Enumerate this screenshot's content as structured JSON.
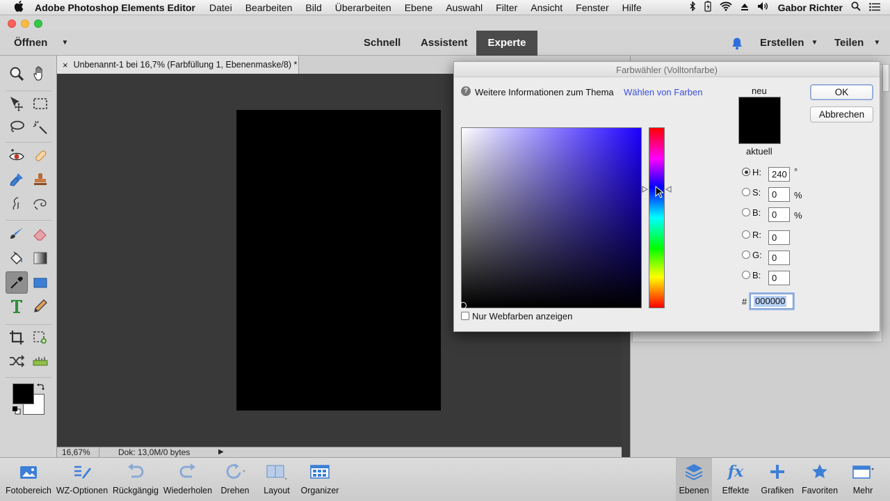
{
  "menubar": {
    "app_name": "Adobe Photoshop Elements Editor",
    "items": [
      "Datei",
      "Bearbeiten",
      "Bild",
      "Überarbeiten",
      "Ebene",
      "Auswahl",
      "Filter",
      "Ansicht",
      "Fenster",
      "Hilfe"
    ],
    "user": "Gabor Richter"
  },
  "topbar": {
    "open_label": "Öffnen",
    "modes": [
      "Schnell",
      "Assistent",
      "Experte"
    ],
    "active_mode": "Experte",
    "create_label": "Erstellen",
    "share_label": "Teilen"
  },
  "document": {
    "tab_title": "Unbenannt-1 bei 16,7% (Farbfüllung 1, Ebenenmaske/8) *",
    "zoom": "16,67%",
    "doc_info": "Dok: 13,0M/0 bytes"
  },
  "bottombar": {
    "items": [
      "Fotobereich",
      "WZ-Optionen",
      "Rückgängig",
      "Wiederholen",
      "Drehen",
      "Layout",
      "Organizer"
    ],
    "panels": [
      "Ebenen",
      "Effekte",
      "Grafiken",
      "Favoriten",
      "Mehr"
    ]
  },
  "dialog": {
    "title": "Farbwähler (Volltonfarbe)",
    "info_text": "Weitere Informationen zum Thema",
    "info_link": "Wählen von Farben",
    "new_label": "neu",
    "current_label": "aktuell",
    "ok_label": "OK",
    "cancel_label": "Abbrechen",
    "fields": {
      "h": {
        "label": "H:",
        "value": "240",
        "unit": "°"
      },
      "s": {
        "label": "S:",
        "value": "0",
        "unit": "%"
      },
      "b": {
        "label": "B:",
        "value": "0",
        "unit": "%"
      },
      "r": {
        "label": "R:",
        "value": "0"
      },
      "g": {
        "label": "G:",
        "value": "0"
      },
      "b2": {
        "label": "B:",
        "value": "0"
      }
    },
    "hex_label": "#",
    "hex_value": "000000",
    "webcolors_label": "Nur Webfarben anzeigen",
    "selected_mode": "H"
  },
  "colors": {
    "accent": "#2c6fdc",
    "link": "#3b4fd8",
    "field_hue": "#1c00ff"
  }
}
